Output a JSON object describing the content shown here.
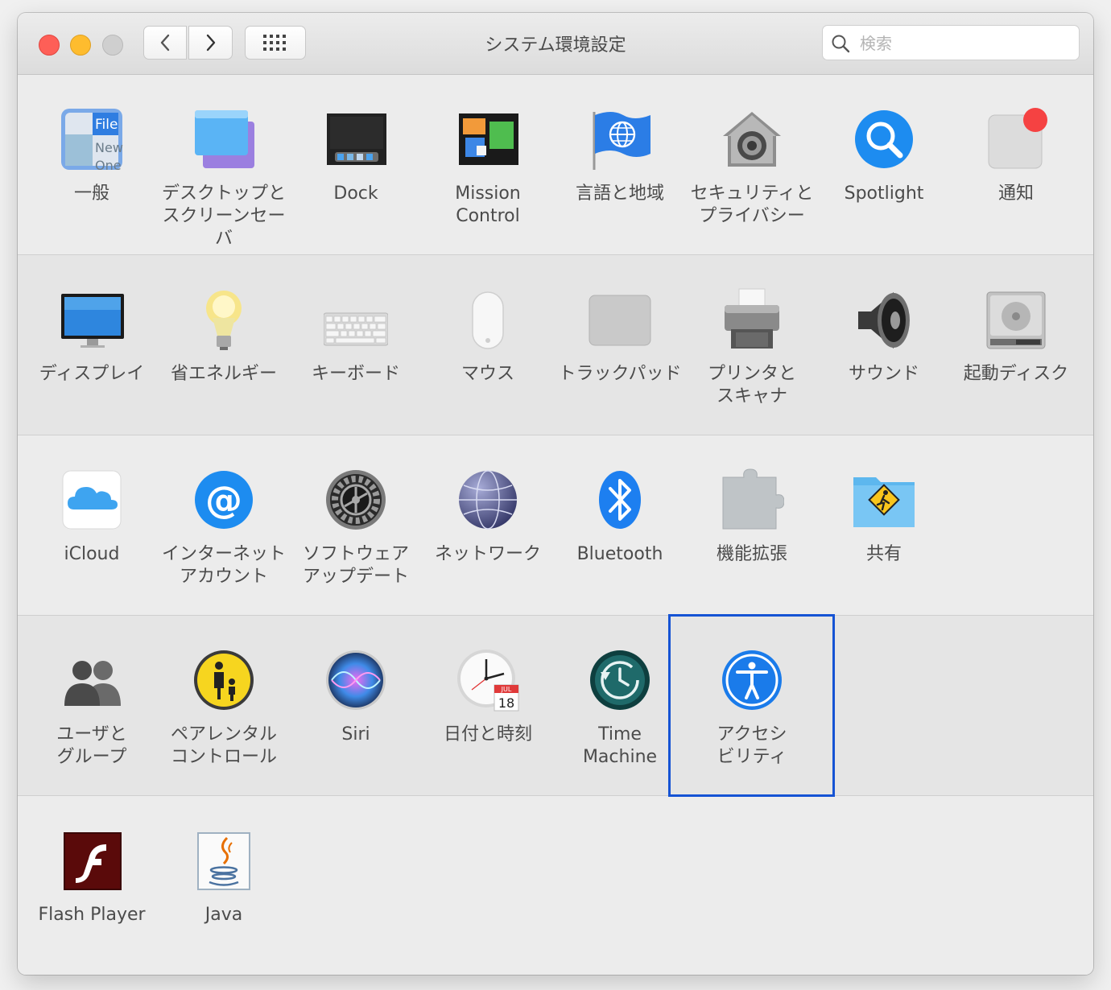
{
  "window": {
    "title": "システム環境設定",
    "search_placeholder": "検索"
  },
  "rows": [
    {
      "panes": [
        {
          "label": "一般",
          "icon": "general-icon"
        },
        {
          "label": "デスクトップと\nスクリーンセーバ",
          "icon": "desktop-screensaver-icon"
        },
        {
          "label": "Dock",
          "icon": "dock-icon"
        },
        {
          "label": "Mission\nControl",
          "icon": "mission-control-icon"
        },
        {
          "label": "言語と地域",
          "icon": "language-region-icon"
        },
        {
          "label": "セキュリティと\nプライバシー",
          "icon": "security-privacy-icon"
        },
        {
          "label": "Spotlight",
          "icon": "spotlight-icon"
        },
        {
          "label": "通知",
          "icon": "notifications-icon"
        }
      ]
    },
    {
      "panes": [
        {
          "label": "ディスプレイ",
          "icon": "display-icon"
        },
        {
          "label": "省エネルギー",
          "icon": "energy-saver-icon"
        },
        {
          "label": "キーボード",
          "icon": "keyboard-icon"
        },
        {
          "label": "マウス",
          "icon": "mouse-icon"
        },
        {
          "label": "トラックパッド",
          "icon": "trackpad-icon"
        },
        {
          "label": "プリンタと\nスキャナ",
          "icon": "printer-scanner-icon"
        },
        {
          "label": "サウンド",
          "icon": "sound-icon"
        },
        {
          "label": "起動ディスク",
          "icon": "startup-disk-icon"
        }
      ]
    },
    {
      "panes": [
        {
          "label": "iCloud",
          "icon": "icloud-icon"
        },
        {
          "label": "インターネット\nアカウント",
          "icon": "internet-accounts-icon"
        },
        {
          "label": "ソフトウェア\nアップデート",
          "icon": "software-update-icon"
        },
        {
          "label": "ネットワーク",
          "icon": "network-icon"
        },
        {
          "label": "Bluetooth",
          "icon": "bluetooth-icon"
        },
        {
          "label": "機能拡張",
          "icon": "extensions-icon"
        },
        {
          "label": "共有",
          "icon": "sharing-icon"
        }
      ]
    },
    {
      "panes": [
        {
          "label": "ユーザと\nグループ",
          "icon": "users-groups-icon"
        },
        {
          "label": "ペアレンタル\nコントロール",
          "icon": "parental-controls-icon"
        },
        {
          "label": "Siri",
          "icon": "siri-icon"
        },
        {
          "label": "日付と時刻",
          "icon": "date-time-icon"
        },
        {
          "label": "Time\nMachine",
          "icon": "time-machine-icon"
        },
        {
          "label": "アクセシ\nビリティ",
          "icon": "accessibility-icon"
        }
      ]
    },
    {
      "panes": [
        {
          "label": "Flash Player",
          "icon": "flash-player-icon"
        },
        {
          "label": "Java",
          "icon": "java-icon"
        }
      ]
    }
  ],
  "icon_text": {
    "general_file": "File",
    "general_new": "New",
    "general_one": "One",
    "calendar_month": "JUL",
    "calendar_day": "18"
  },
  "selected_pane": "アクセシ\nビリティ",
  "colors": {
    "selection_border": "#1553d4",
    "close": "#fe5f57",
    "minimize": "#febc2e",
    "zoom_disabled": "#cfcfcf"
  }
}
